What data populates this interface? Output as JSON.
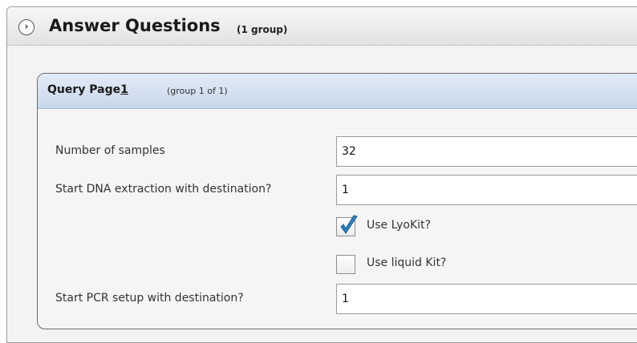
{
  "header": {
    "title": "Answer Questions",
    "subtitle": "(1 group)",
    "expand_icon": "chevron-right-icon"
  },
  "panel": {
    "title_main": "Query Page",
    "title_accel": "1",
    "subtitle": "(group 1 of 1)"
  },
  "form": {
    "num_samples_label": "Number of samples",
    "num_samples_value": "32",
    "dna_label": "Start DNA extraction with destination?",
    "dna_value": "1",
    "lyokit_label": "Use LyoKit?",
    "lyokit_checked": true,
    "liquid_label": "Use liquid Kit?",
    "liquid_checked": false,
    "pcr_label": "Start PCR setup with destination?",
    "pcr_value": "1"
  },
  "colors": {
    "check_color": "#2a7fc0",
    "panel_header_blue": "#c7d6ea"
  }
}
